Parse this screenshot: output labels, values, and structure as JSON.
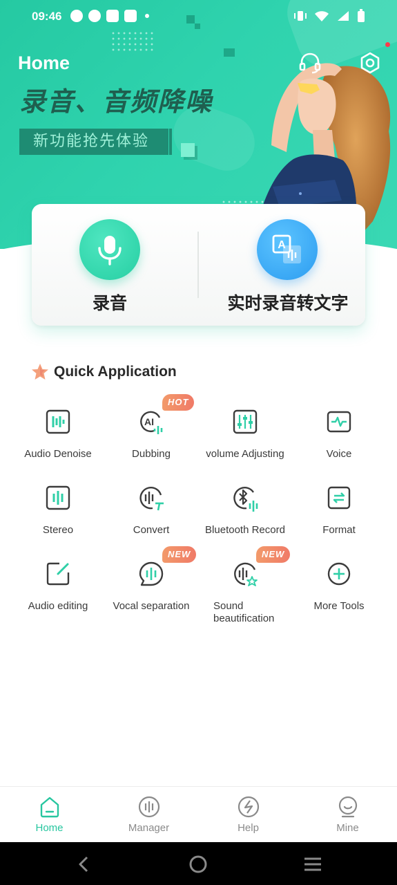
{
  "status_bar": {
    "time": "09:46"
  },
  "header": {
    "title": "Home",
    "promo_main": "录音、音频降噪",
    "promo_sub": "新功能抢先体验"
  },
  "actions": [
    {
      "label": "录音"
    },
    {
      "label": "实时录音转文字"
    }
  ],
  "quick_application": {
    "title": "Quick Application",
    "tools": [
      {
        "label": "Audio Denoise"
      },
      {
        "label": "Dubbing",
        "badge": "HOT"
      },
      {
        "label": "volume Adjusting"
      },
      {
        "label": "Voice"
      },
      {
        "label": "Stereo"
      },
      {
        "label": "Convert"
      },
      {
        "label": "Bluetooth Record"
      },
      {
        "label": "Format"
      },
      {
        "label": "Audio editing"
      },
      {
        "label": "Vocal separation",
        "badge": "NEW"
      },
      {
        "label": "Sound beautification",
        "badge": "NEW"
      },
      {
        "label": "More Tools"
      }
    ]
  },
  "bottom_nav": [
    {
      "label": "Home",
      "active": true
    },
    {
      "label": "Manager"
    },
    {
      "label": "Help"
    },
    {
      "label": "Mine"
    }
  ],
  "colors": {
    "accent": "#27c69f",
    "banner": "#2fd3ae",
    "badge": "#f07a67",
    "blue": "#2c9cf0"
  },
  "icons": {
    "ai_label": "AI",
    "translate_label": "A"
  }
}
